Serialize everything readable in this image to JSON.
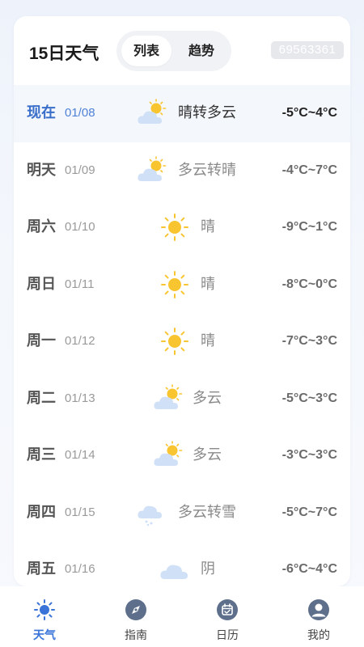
{
  "header": {
    "title": "15日天气",
    "tabs": [
      {
        "label": "列表",
        "active": true
      },
      {
        "label": "趋势",
        "active": false
      }
    ],
    "code": "69563361"
  },
  "days": [
    {
      "day": "现在",
      "date": "01/08",
      "icon": "partly-cloudy-icon",
      "condition": "晴转多云",
      "temp": "-5°C~4°C",
      "current": true
    },
    {
      "day": "明天",
      "date": "01/09",
      "icon": "partly-cloudy-icon",
      "condition": "多云转晴",
      "temp": "-4°C~7°C"
    },
    {
      "day": "周六",
      "date": "01/10",
      "icon": "sun-icon",
      "condition": "晴",
      "temp": "-9°C~1°C"
    },
    {
      "day": "周日",
      "date": "01/11",
      "icon": "sun-icon",
      "condition": "晴",
      "temp": "-8°C~0°C"
    },
    {
      "day": "周一",
      "date": "01/12",
      "icon": "sun-icon",
      "condition": "晴",
      "temp": "-7°C~3°C"
    },
    {
      "day": "周二",
      "date": "01/13",
      "icon": "partly-cloudy-icon",
      "condition": "多云",
      "temp": "-5°C~3°C"
    },
    {
      "day": "周三",
      "date": "01/14",
      "icon": "partly-cloudy-icon",
      "condition": "多云",
      "temp": "-3°C~3°C"
    },
    {
      "day": "周四",
      "date": "01/15",
      "icon": "cloud-snow-icon",
      "condition": "多云转雪",
      "temp": "-5°C~7°C"
    },
    {
      "day": "周五",
      "date": "01/16",
      "icon": "overcast-cloud-icon",
      "condition": "阴",
      "temp": "-6°C~4°C"
    }
  ],
  "tabbar": [
    {
      "label": "天气",
      "icon": "sun-icon",
      "active": true
    },
    {
      "label": "指南",
      "icon": "compass-icon",
      "active": false
    },
    {
      "label": "日历",
      "icon": "calendar-icon",
      "active": false
    },
    {
      "label": "我的",
      "icon": "user-icon",
      "active": false
    }
  ],
  "colors": {
    "accent": "#3a74d8",
    "sun": "#f8c531",
    "cloud": "#cfe0f7",
    "tab_icon_inactive": "#5e6f8c"
  }
}
